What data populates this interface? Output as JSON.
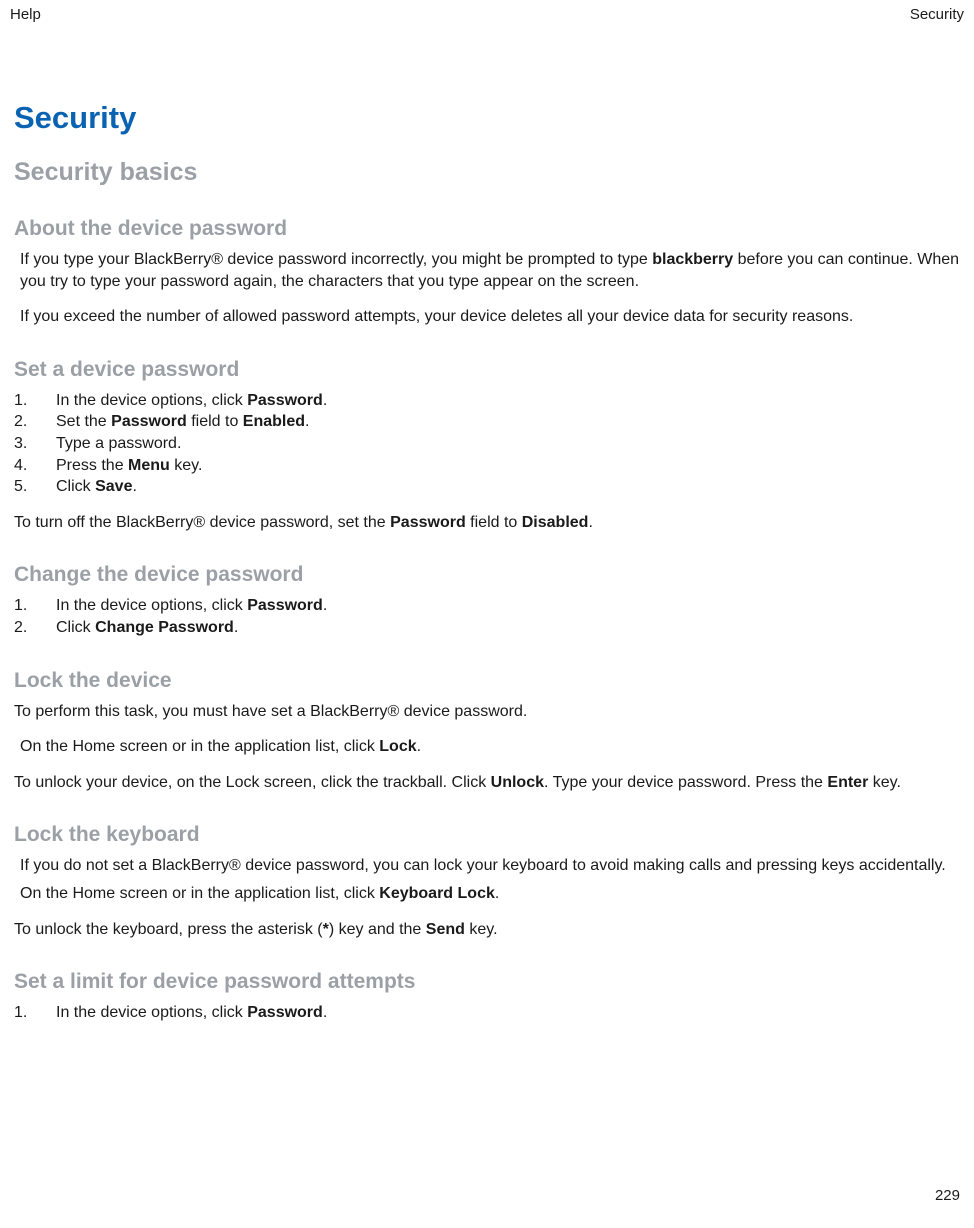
{
  "header": {
    "left": "Help",
    "right": "Security"
  },
  "page_number": "229",
  "title": "Security",
  "subtitle": "Security basics",
  "sections": {
    "about": {
      "heading": "About the device password",
      "p1_pre": "If you type your BlackBerry® device password incorrectly, you might be prompted to type ",
      "p1_b1": "blackberry",
      "p1_post": " before you can continue. When you try to type your password again, the characters that you type appear on the screen.",
      "p2": "If you exceed the number of allowed password attempts, your device deletes all your device data for security reasons."
    },
    "set": {
      "heading": "Set a device password",
      "steps": [
        {
          "pre": "In the device options, click ",
          "b": "Password",
          "post": "."
        },
        {
          "pre": "Set the ",
          "b": "Password",
          "mid": " field to ",
          "b2": "Enabled",
          "post": "."
        },
        {
          "pre": "Type a password.",
          "b": "",
          "post": ""
        },
        {
          "pre": "Press the ",
          "b": "Menu",
          "post": " key."
        },
        {
          "pre": "Click ",
          "b": "Save",
          "post": "."
        }
      ],
      "after_pre": "To turn off the BlackBerry® device password, set the ",
      "after_b1": "Password",
      "after_mid": " field to ",
      "after_b2": "Disabled",
      "after_post": "."
    },
    "change": {
      "heading": "Change the device password",
      "steps": [
        {
          "pre": "In the device options, click ",
          "b": "Password",
          "post": "."
        },
        {
          "pre": "Click ",
          "b": "Change Password",
          "post": "."
        }
      ]
    },
    "lock_device": {
      "heading": "Lock the device",
      "p1": "To perform this task, you must have set a BlackBerry® device password.",
      "p2_pre": "On the Home screen or in the application list, click ",
      "p2_b": "Lock",
      "p2_post": ".",
      "p3_pre": "To unlock your device, on the Lock screen, click the trackball. Click ",
      "p3_b1": "Unlock",
      "p3_mid": ". Type your device password. Press the ",
      "p3_b2": "Enter",
      "p3_post": " key."
    },
    "lock_keyboard": {
      "heading": "Lock the keyboard",
      "p1": "If you do not set a BlackBerry® device password, you can lock your keyboard to avoid making calls and pressing keys accidentally.",
      "p2_pre": "On the Home screen or in the application list, click ",
      "p2_b": "Keyboard Lock",
      "p2_post": ".",
      "p3_pre": "To unlock the keyboard, press the asterisk (",
      "p3_b1": "*",
      "p3_mid": ") key and the ",
      "p3_b2": "Send",
      "p3_post": " key."
    },
    "limit": {
      "heading": "Set a limit for device password attempts",
      "steps": [
        {
          "pre": "In the device options, click ",
          "b": "Password",
          "post": "."
        }
      ]
    }
  }
}
